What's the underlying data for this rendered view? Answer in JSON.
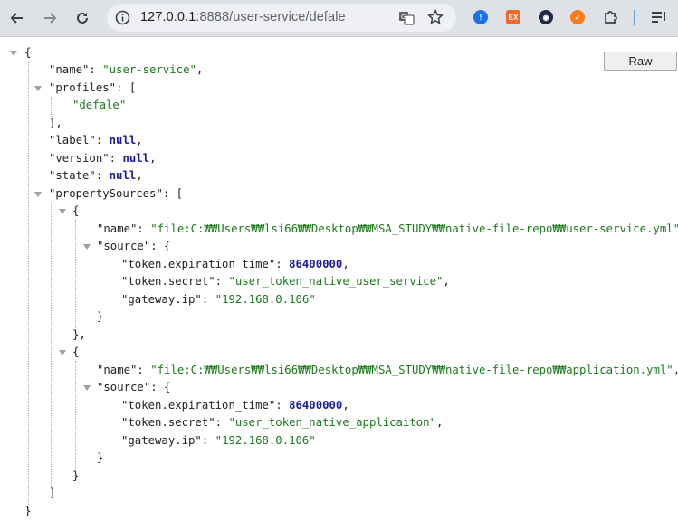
{
  "browser": {
    "url_host": "127.0.0.1",
    "url_rest": ":8888/user-service/defale",
    "colors": {
      "toolbar": "#dee1e6",
      "omnibox": "#eef0f3"
    },
    "icons": [
      "back-icon",
      "forward-icon",
      "reload-icon",
      "site-info-icon",
      "translate-icon",
      "bookmark-star-icon",
      "extension-icons",
      "puzzle-icon",
      "reading-list-icon"
    ]
  },
  "viewer": {
    "raw_label": "Raw",
    "json": {
      "name": "user-service",
      "profiles": [
        "defale"
      ],
      "label": "null",
      "version": "null",
      "state": "null",
      "propertySources": [
        {
          "name": "file:C:₩₩Users₩₩lsi66₩₩Desktop₩₩MSA_STUDY₩₩native-file-repo₩₩user-service.yml",
          "source": {
            "token.expiration_time": "86400000",
            "token.secret": "user_token_native_user_service",
            "gateway.ip": "192.168.0.106"
          }
        },
        {
          "name": "file:C:₩₩Users₩₩lsi66₩₩Desktop₩₩MSA_STUDY₩₩native-file-repo₩₩application.yml",
          "source": {
            "token.expiration_time": "86400000",
            "token.secret": "user_token_native_applicaiton",
            "gateway.ip": "192.168.0.106"
          }
        }
      ]
    }
  }
}
